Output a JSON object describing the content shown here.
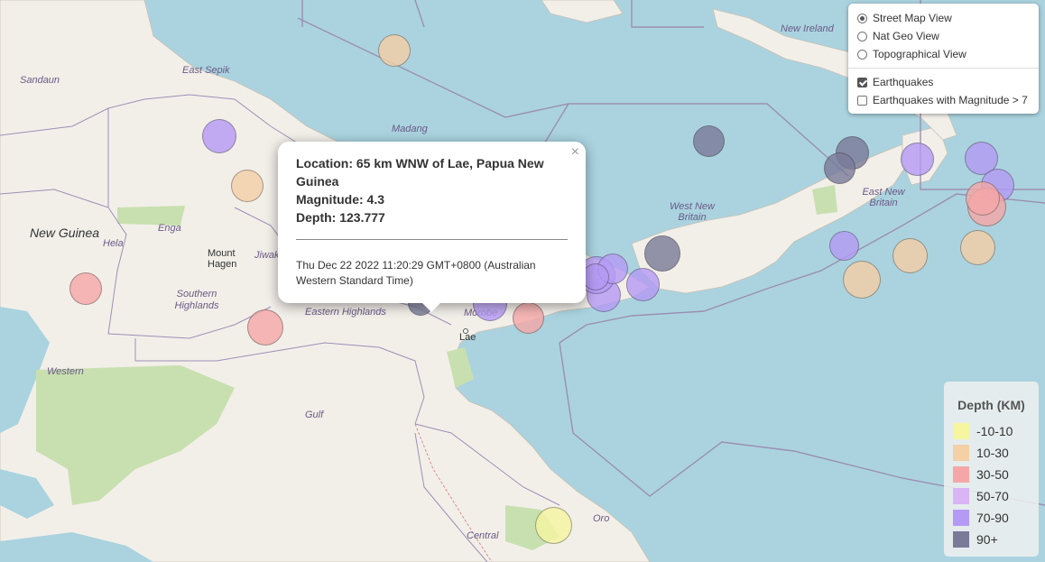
{
  "map": {
    "labels": [
      {
        "text": "Sandaun",
        "cls": "place"
      },
      {
        "text": "East Sepik",
        "cls": "place"
      },
      {
        "text": "Madang",
        "cls": "place"
      },
      {
        "text": "New Ireland",
        "cls": "place"
      },
      {
        "text": "Enga",
        "cls": "place"
      },
      {
        "text": "New Guinea",
        "cls": "place big"
      },
      {
        "text": "Hela",
        "cls": "place"
      },
      {
        "text": "Mount Hagen",
        "cls": "place town"
      },
      {
        "text": "Jiwaka",
        "cls": "place"
      },
      {
        "text": "Southern Highlands",
        "cls": "place"
      },
      {
        "text": "Eastern Highlands",
        "cls": "place"
      },
      {
        "text": "Morobe",
        "cls": "place"
      },
      {
        "text": "Lae",
        "cls": "place town"
      },
      {
        "text": "West New Britain",
        "cls": "place"
      },
      {
        "text": "East New Britain",
        "cls": "place"
      },
      {
        "text": "Western",
        "cls": "place"
      },
      {
        "text": "Gulf",
        "cls": "place"
      },
      {
        "text": "Oro",
        "cls": "place"
      },
      {
        "text": "Central",
        "cls": "place"
      }
    ],
    "earthquakes": [
      {
        "depth_band": "10-30"
      },
      {
        "depth_band": "70-90"
      },
      {
        "depth_band": "10-30"
      },
      {
        "depth_band": "30-50"
      },
      {
        "depth_band": "30-50"
      },
      {
        "depth_band": "90+"
      },
      {
        "depth_band": "90+"
      },
      {
        "depth_band": "90+"
      },
      {
        "depth_band": "70-90"
      },
      {
        "depth_band": "70-90"
      },
      {
        "depth_band": "70-90"
      },
      {
        "depth_band": "30-50"
      },
      {
        "depth_band": "30-50"
      },
      {
        "depth_band": "10-30"
      },
      {
        "depth_band": "70-90"
      },
      {
        "depth_band": "10-30"
      },
      {
        "depth_band": "10-30"
      },
      {
        "depth_band": "90+"
      },
      {
        "depth_band": "70-90"
      },
      {
        "depth_band": "70-90"
      },
      {
        "depth_band": "70-90"
      },
      {
        "depth_band": "70-90"
      },
      {
        "depth_band": "70-90"
      },
      {
        "depth_band": "30-50"
      },
      {
        "depth_band": "70-90"
      },
      {
        "depth_band": "90+"
      },
      {
        "depth_band": "-10-10"
      }
    ]
  },
  "layer_control": {
    "base_layers": [
      {
        "label": "Street Map View",
        "selected": true
      },
      {
        "label": "Nat Geo View",
        "selected": false
      },
      {
        "label": "Topographical View",
        "selected": false
      }
    ],
    "overlays": [
      {
        "label": "Earthquakes",
        "checked": true
      },
      {
        "label": "Earthquakes with Magnitude > 7",
        "checked": false
      }
    ]
  },
  "popup": {
    "location": "Location: 65 km WNW of Lae, Papua New Guinea",
    "magnitude": "Magnitude: 4.3",
    "depth": "Depth: 123.777",
    "time": "Thu Dec 22 2022 11:20:29 GMT+0800 (Australian Western Standard Time)",
    "close": "×"
  },
  "legend": {
    "title": "Depth (KM)",
    "items": [
      {
        "label": "-10-10",
        "color": "#f6f6a0"
      },
      {
        "label": "10-30",
        "color": "#f5cfa6"
      },
      {
        "label": "30-50",
        "color": "#f5a7a7"
      },
      {
        "label": "50-70",
        "color": "#d9b5f5"
      },
      {
        "label": "70-90",
        "color": "#b59af5"
      },
      {
        "label": "90+",
        "color": "#7a7a99"
      }
    ]
  },
  "colors": {
    "sea": "#aad3df",
    "land": "#f2efe9",
    "park": "#c8e0b0",
    "border": "#9e8fb5"
  }
}
